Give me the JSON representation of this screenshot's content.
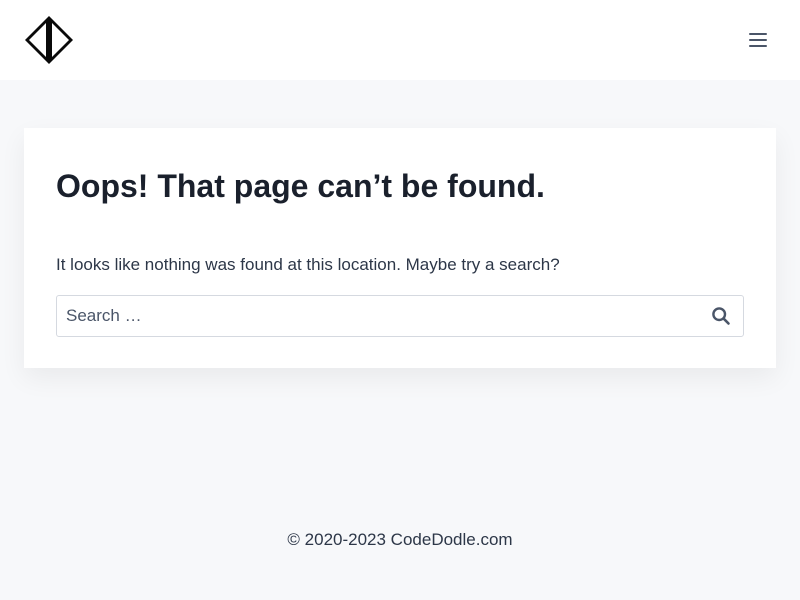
{
  "header": {
    "logo_icon": "codedodle-diamond-logo",
    "menu_icon": "hamburger-menu-icon"
  },
  "main": {
    "title": "Oops! That page can’t be found.",
    "message": "It looks like nothing was found at this location. Maybe try a search?",
    "search": {
      "placeholder": "Search …",
      "value": "",
      "button_icon": "search-icon"
    }
  },
  "footer": {
    "copyright": "© 2020-2023 CodeDodle.com"
  },
  "colors": {
    "background": "#f7f8fa",
    "card": "#ffffff",
    "title": "#1a202c",
    "text": "#2d3748",
    "icon": "#4a5568"
  }
}
